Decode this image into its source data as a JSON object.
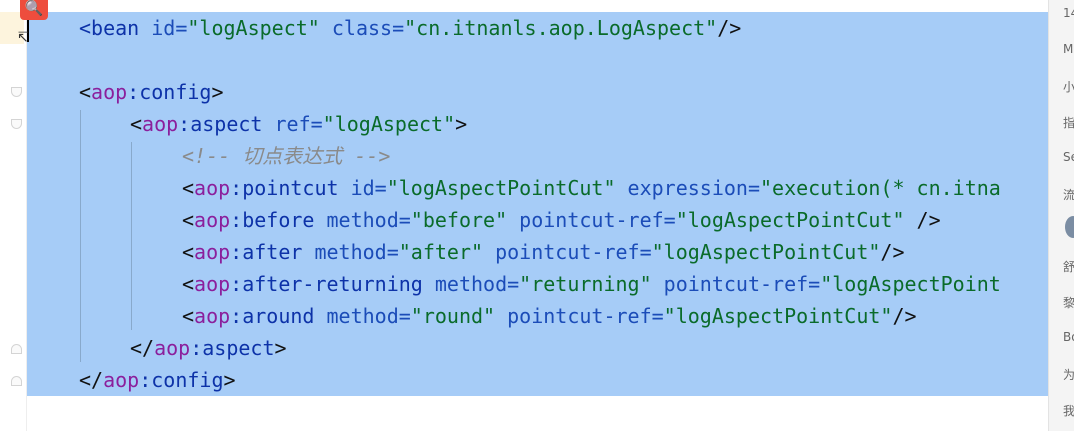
{
  "editor": {
    "lines": [
      {
        "parts": [
          [
            "tag",
            "<bean "
          ],
          [
            "attr",
            "id="
          ],
          [
            "val",
            "\"logAspect\" "
          ],
          [
            "attr",
            "class="
          ],
          [
            "val",
            "\"cn.itnanls.aop.LogAspect\""
          ],
          [
            "punc",
            "/>"
          ]
        ]
      },
      {
        "parts": []
      },
      {
        "parts": [
          [
            "punc",
            "<"
          ],
          [
            "ns",
            "aop"
          ],
          [
            "tag",
            ":config"
          ],
          [
            "punc",
            ">"
          ]
        ]
      },
      {
        "parts": [
          [
            "punc",
            "<"
          ],
          [
            "ns",
            "aop"
          ],
          [
            "tag",
            ":aspect "
          ],
          [
            "attr",
            "ref="
          ],
          [
            "val",
            "\"logAspect\""
          ],
          [
            "punc",
            ">"
          ]
        ]
      },
      {
        "parts": [
          [
            "cmt",
            "<!-- 切点表达式 -->"
          ]
        ]
      },
      {
        "parts": [
          [
            "punc",
            "<"
          ],
          [
            "ns",
            "aop"
          ],
          [
            "tag",
            ":pointcut "
          ],
          [
            "attr",
            "id="
          ],
          [
            "val",
            "\"logAspectPointCut\" "
          ],
          [
            "attr",
            "expression="
          ],
          [
            "val",
            "\"execution(* cn.itna"
          ]
        ]
      },
      {
        "parts": [
          [
            "punc",
            "<"
          ],
          [
            "ns",
            "aop"
          ],
          [
            "tag",
            ":before "
          ],
          [
            "attr",
            "method="
          ],
          [
            "val",
            "\"before\" "
          ],
          [
            "attr",
            "pointcut-ref="
          ],
          [
            "val",
            "\"logAspectPointCut\" "
          ],
          [
            "punc",
            "/>"
          ]
        ]
      },
      {
        "parts": [
          [
            "punc",
            "<"
          ],
          [
            "ns",
            "aop"
          ],
          [
            "tag",
            ":after "
          ],
          [
            "attr",
            "method="
          ],
          [
            "val",
            "\"after\" "
          ],
          [
            "attr",
            "pointcut-ref="
          ],
          [
            "val",
            "\"logAspectPointCut\""
          ],
          [
            "punc",
            "/>"
          ]
        ]
      },
      {
        "parts": [
          [
            "punc",
            "<"
          ],
          [
            "ns",
            "aop"
          ],
          [
            "tag",
            ":after-returning "
          ],
          [
            "attr",
            "method="
          ],
          [
            "val",
            "\"returning\" "
          ],
          [
            "attr",
            "pointcut-ref="
          ],
          [
            "val",
            "\"logAspectPoint"
          ]
        ]
      },
      {
        "parts": [
          [
            "punc",
            "<"
          ],
          [
            "ns",
            "aop"
          ],
          [
            "tag",
            ":around "
          ],
          [
            "attr",
            "method="
          ],
          [
            "val",
            "\"round\" "
          ],
          [
            "attr",
            "pointcut-ref="
          ],
          [
            "val",
            "\"logAspectPointCut\""
          ],
          [
            "punc",
            "/>"
          ]
        ]
      },
      {
        "parts": [
          [
            "punc",
            "</"
          ],
          [
            "ns",
            "aop"
          ],
          [
            "tag",
            ":aspect"
          ],
          [
            "punc",
            ">"
          ]
        ]
      },
      {
        "parts": [
          [
            "punc",
            "</"
          ],
          [
            "ns",
            "aop"
          ],
          [
            "tag",
            ":config"
          ],
          [
            "punc",
            ">"
          ]
        ]
      }
    ]
  },
  "right_panel": {
    "items": [
      "14",
      "M",
      "小",
      "指",
      "Se",
      "流",
      "",
      "舒",
      "黎",
      "Bo",
      "为",
      "我"
    ]
  },
  "icons": {
    "search_badge": "🔍"
  }
}
